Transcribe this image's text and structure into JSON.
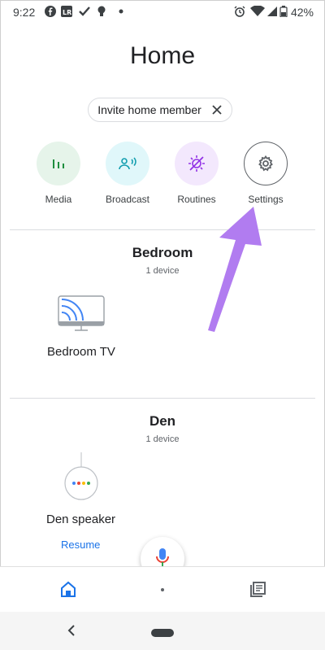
{
  "status_bar": {
    "time": "9:22",
    "battery_percent": "42%",
    "left_icons": [
      "facebook-icon",
      "lr-icon",
      "check-icon",
      "bulb-icon",
      "dot-icon"
    ],
    "right_icons": [
      "alarm-icon",
      "wifi-icon",
      "signal-icon",
      "battery-icon"
    ]
  },
  "header": {
    "title": "Home"
  },
  "invite": {
    "label": "Invite home member"
  },
  "quick_actions": [
    {
      "label": "Media",
      "icon": "media-icon",
      "bg": "#e6f4ea",
      "fg": "#1e8e3e"
    },
    {
      "label": "Broadcast",
      "icon": "broadcast-icon",
      "bg": "#e0f7fa",
      "fg": "#129eaf"
    },
    {
      "label": "Routines",
      "icon": "routines-icon",
      "bg": "#f3e8fd",
      "fg": "#9334e6"
    },
    {
      "label": "Settings",
      "icon": "settings-icon",
      "bg": "#ffffff",
      "fg": "#5f6368"
    }
  ],
  "rooms": [
    {
      "name": "Bedroom",
      "count": "1 device",
      "devices": [
        {
          "label": "Bedroom TV",
          "icon": "tv-cast-icon"
        }
      ]
    },
    {
      "name": "Den",
      "count": "1 device",
      "devices": [
        {
          "label": "Den speaker",
          "icon": "speaker-icon",
          "action": "Resume"
        }
      ]
    }
  ],
  "colors": {
    "accent": "#1a73e8",
    "annotation_arrow": "#b17cf0"
  }
}
